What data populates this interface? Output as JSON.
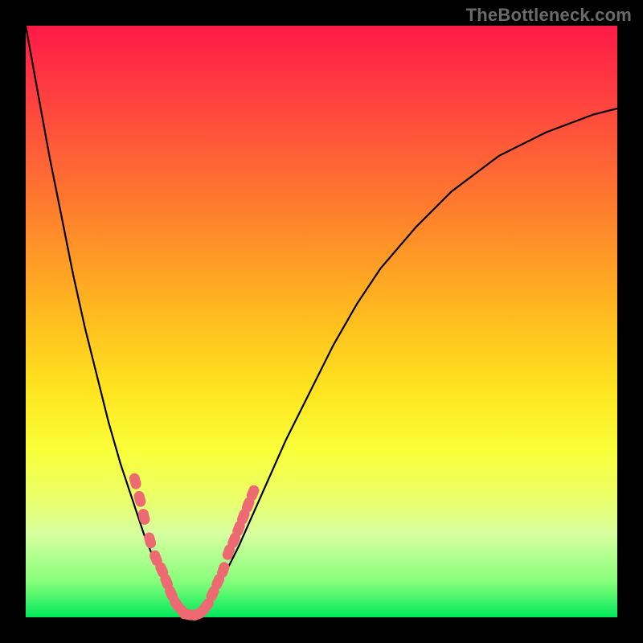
{
  "watermark": "TheBottleneck.com",
  "chart_data": {
    "type": "line",
    "title": "",
    "xlabel": "",
    "ylabel": "",
    "xlim": [
      0,
      100
    ],
    "ylim": [
      0,
      100
    ],
    "grid": false,
    "legend": false,
    "series": [
      {
        "name": "bottleneck-curve",
        "stroke": "#000000",
        "x": [
          0,
          2,
          4,
          6,
          8,
          10,
          12,
          14,
          16,
          18,
          20,
          22,
          24,
          26,
          28,
          30,
          32,
          36,
          40,
          44,
          48,
          52,
          56,
          60,
          66,
          72,
          80,
          88,
          96,
          100
        ],
        "y": [
          100,
          89,
          78,
          68,
          58,
          49,
          41,
          33,
          26,
          20,
          14,
          9,
          5,
          2,
          0.5,
          0.5,
          4,
          12,
          21,
          30,
          38,
          46,
          53,
          59,
          66,
          72,
          78,
          82,
          85,
          86
        ]
      }
    ],
    "markers": [
      {
        "name": "left-arm-markers",
        "color": "#ed6a72",
        "points": [
          {
            "x": 18.5,
            "y": 23
          },
          {
            "x": 19.3,
            "y": 20
          },
          {
            "x": 20.0,
            "y": 17
          },
          {
            "x": 21.0,
            "y": 13
          },
          {
            "x": 22.0,
            "y": 10
          },
          {
            "x": 23.0,
            "y": 8
          },
          {
            "x": 23.8,
            "y": 6
          },
          {
            "x": 24.6,
            "y": 4
          },
          {
            "x": 25.5,
            "y": 2.2
          },
          {
            "x": 26.5,
            "y": 1
          }
        ]
      },
      {
        "name": "valley-markers",
        "color": "#ed6a72",
        "points": [
          {
            "x": 27.3,
            "y": 0.5
          },
          {
            "x": 28.2,
            "y": 0.4
          },
          {
            "x": 29.0,
            "y": 0.5
          },
          {
            "x": 29.8,
            "y": 1
          },
          {
            "x": 30.6,
            "y": 2
          }
        ]
      },
      {
        "name": "right-arm-markers",
        "color": "#ed6a72",
        "points": [
          {
            "x": 31.6,
            "y": 4
          },
          {
            "x": 32.5,
            "y": 6
          },
          {
            "x": 33.4,
            "y": 8
          },
          {
            "x": 34.3,
            "y": 11
          },
          {
            "x": 35.2,
            "y": 13
          },
          {
            "x": 36.0,
            "y": 15
          },
          {
            "x": 36.8,
            "y": 17
          },
          {
            "x": 37.6,
            "y": 19
          },
          {
            "x": 38.4,
            "y": 21
          }
        ]
      }
    ],
    "background": {
      "gradient_stops": [
        {
          "pos": 0,
          "color": "#ff1a47"
        },
        {
          "pos": 30,
          "color": "#ff7a2e"
        },
        {
          "pos": 62,
          "color": "#ffe61f"
        },
        {
          "pos": 86,
          "color": "#d6ffa0"
        },
        {
          "pos": 100,
          "color": "#00e85b"
        }
      ]
    }
  }
}
